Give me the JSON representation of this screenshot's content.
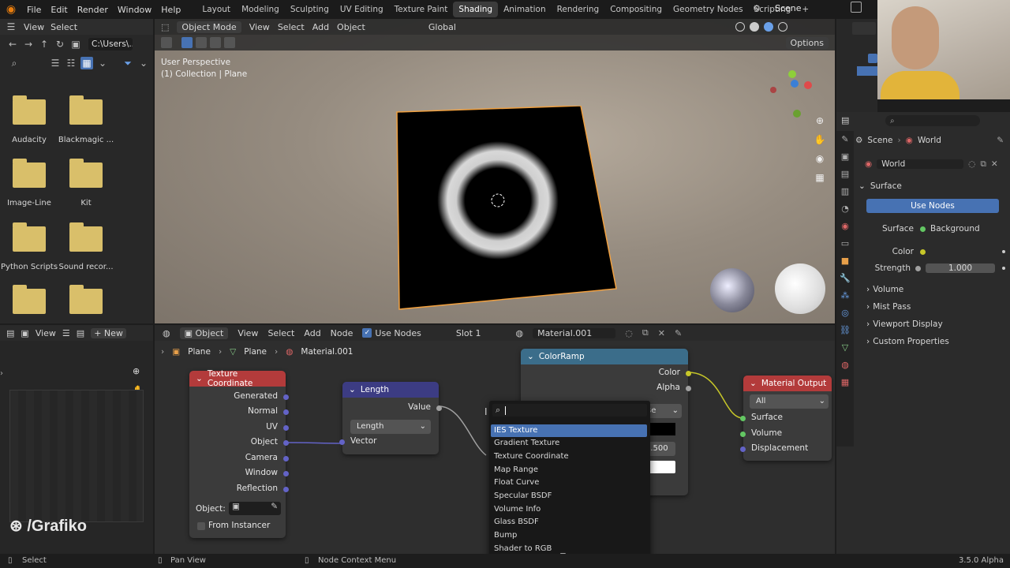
{
  "topbar": {
    "menus": [
      "File",
      "Edit",
      "Render",
      "Window",
      "Help"
    ],
    "workspaces": [
      "Layout",
      "Modeling",
      "Sculpting",
      "UV Editing",
      "Texture Paint",
      "Shading",
      "Animation",
      "Rendering",
      "Compositing",
      "Geometry Nodes",
      "Scripting"
    ],
    "active_workspace": "Shading",
    "add_workspace": "+",
    "scene": "Scene"
  },
  "filebrowser": {
    "menus": [
      "View",
      "Select"
    ],
    "path": "C:\\Users\\...",
    "folders": [
      "Audacity",
      "Blackmagic ...",
      "Image-Line",
      "Kit",
      "Python Scripts",
      "Sound recor...",
      "",
      ""
    ]
  },
  "viewport": {
    "mode": "Object Mode",
    "menus": [
      "View",
      "Select",
      "Add",
      "Object"
    ],
    "transform": "Global",
    "options": "Options",
    "info_line1": "User Perspective",
    "info_line2": "(1) Collection | Plane"
  },
  "properties": {
    "breadcrumb_scene": "Scene",
    "breadcrumb_world": "World",
    "world_name": "World",
    "surface_panel": "Surface",
    "use_nodes": "Use Nodes",
    "surface_label": "Surface",
    "surface_value": "Background",
    "color_label": "Color",
    "strength_label": "Strength",
    "strength_value": "1.000",
    "panels": [
      "Volume",
      "Mist Pass",
      "Viewport Display",
      "Custom Properties"
    ]
  },
  "left_panel": {
    "menus": [
      "View"
    ],
    "new_label": "New"
  },
  "nodeeditor": {
    "object_mode": "Object",
    "menus": [
      "View",
      "Select",
      "Add",
      "Node"
    ],
    "use_nodes": "Use Nodes",
    "slot": "Slot 1",
    "material": "Material.001",
    "breadcrumb": [
      "Plane",
      "Plane",
      "Material.001"
    ]
  },
  "nodes": {
    "texcoord": {
      "title": "Texture Coordinate",
      "outputs": [
        "Generated",
        "Normal",
        "UV",
        "Object",
        "Camera",
        "Window",
        "Reflection"
      ],
      "object_label": "Object:",
      "from_instancer": "From Instancer",
      "color": "#b33b3b"
    },
    "length": {
      "title": "Length",
      "output": "Value",
      "operation": "Length",
      "input": "Vector",
      "color": "#3c3c83"
    },
    "colorramp": {
      "title": "ColorRamp",
      "outputs": [
        "Color",
        "Alpha"
      ],
      "interp_partial": "se",
      "pos_partial": "0.500",
      "color": "#3b6d8a"
    },
    "output": {
      "title": "Material Output",
      "target": "All",
      "inputs": [
        "Surface",
        "Volume",
        "Displacement"
      ],
      "color": "#b33b3b"
    }
  },
  "search_menu": {
    "items": [
      "IES Texture",
      "Gradient Texture",
      "Texture Coordinate",
      "Map Range",
      "Float Curve",
      "Specular BSDF",
      "Volume Info",
      "Glass BSDF",
      "Bump",
      "Shader to RGB"
    ],
    "active_index": 0
  },
  "statusbar": {
    "select": "Select",
    "pan_view": "Pan View",
    "node_context": "Node Context Menu",
    "version": "3.5.0 Alpha"
  },
  "watermark": "/Grafiko"
}
